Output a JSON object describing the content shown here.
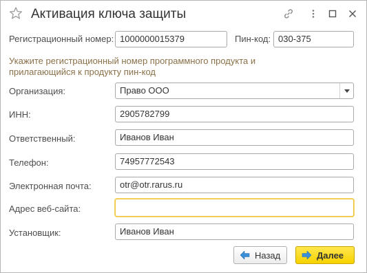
{
  "window": {
    "title": "Активация ключа защиты",
    "icons": [
      "star-icon",
      "link-icon",
      "more-icon",
      "maximize-icon",
      "close-icon"
    ]
  },
  "form": {
    "reg_number": {
      "label": "Регистрационный номер:",
      "value": "1000000015379"
    },
    "pin": {
      "label": "Пин-код:",
      "value": "030-375"
    },
    "hint": "Укажите регистрационный номер программного продукта и прилагающийся к продукту пин-код",
    "organization": {
      "label": "Организация:",
      "value": "Право ООО"
    },
    "inn": {
      "label": "ИНН:",
      "value": "2905782799"
    },
    "responsible": {
      "label": "Ответственный:",
      "value": "Иванов Иван"
    },
    "phone": {
      "label": "Телефон:",
      "value": "74957772543"
    },
    "email": {
      "label": "Электронная почта:",
      "value": "otr@otr.rarus.ru"
    },
    "website": {
      "label": "Адрес веб-сайта:",
      "value": ""
    },
    "installer": {
      "label": "Установщик:",
      "value": "Иванов Иван"
    }
  },
  "buttons": {
    "back": "Назад",
    "next": "Далее"
  },
  "colors": {
    "accent_yellow": "#f6d200",
    "focus_border": "#f2c63c",
    "arrow_blue": "#3a8fd8",
    "hint_text": "#8a7048"
  }
}
